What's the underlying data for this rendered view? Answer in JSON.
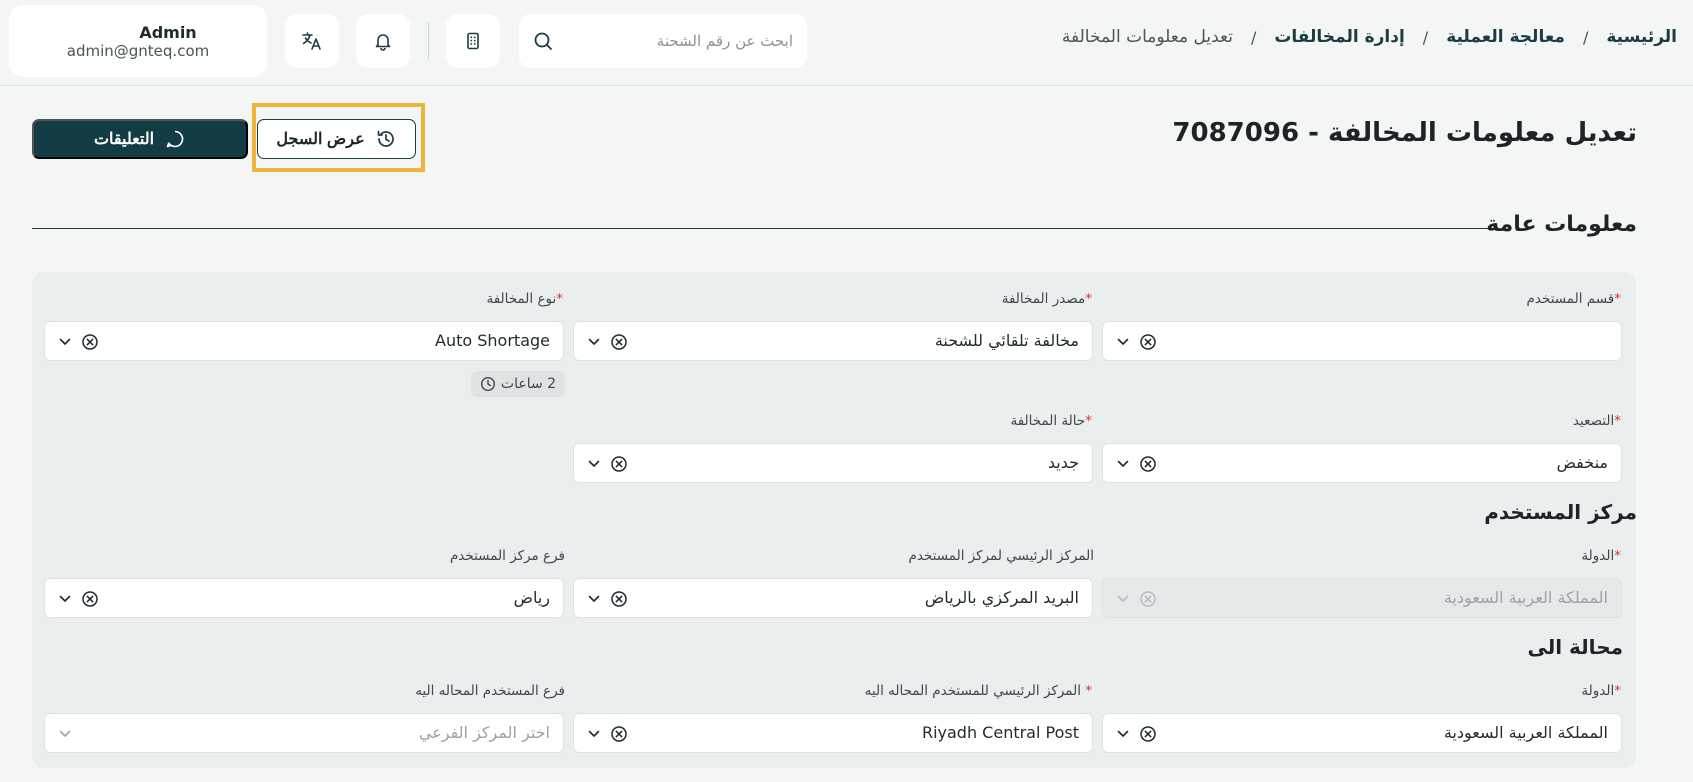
{
  "breadcrumb": {
    "items": [
      "الرئيسية",
      "معالجة العملية",
      "إدارة المخالفات"
    ],
    "current": "تعديل معلومات المخالفة",
    "separator": "/"
  },
  "search": {
    "placeholder": "ابحث عن رقم الشحنة"
  },
  "user": {
    "name": "Admin",
    "email": "admin@gnteq.com"
  },
  "page": {
    "title": "تعديل معلومات المخالفة - 7087096",
    "comments_label": "التعليقات",
    "history_label": "عرض السجل"
  },
  "general_info": {
    "heading": "معلومات عامة",
    "user_department": {
      "label": "قسم المستخدم",
      "value": ""
    },
    "violation_source": {
      "label": "مصدر المخالفة",
      "value": "مخالفة تلقائي للشحنة"
    },
    "violation_type": {
      "label": "نوع المخالفة",
      "value": "Auto Shortage"
    },
    "time_badge": "2 ساعات",
    "escalation": {
      "label": "التصعيد",
      "value": "منخفض"
    },
    "violation_status": {
      "label": "حالة المخالفة",
      "value": "جديد"
    }
  },
  "user_center": {
    "heading": "مركز المستخدم",
    "country": {
      "label": "الدولة",
      "value": "المملكة العربية السعودية"
    },
    "main_center": {
      "label": "المركز الرئيسي لمركز المستخدم",
      "value": "البريد المركزي بالرياض"
    },
    "branch": {
      "label": "فرع مركز المستخدم",
      "value": "رياض"
    }
  },
  "referred_to": {
    "heading": "محالة الى",
    "country": {
      "label": "الدولة",
      "value": "المملكة العربية السعودية"
    },
    "main_center": {
      "label": "المركز الرئيسي للمستخدم المحاله اليه",
      "value": "Riyadh Central Post"
    },
    "branch": {
      "label": "فرع المستخدم المحاله اليه",
      "placeholder": "اختر المركز الفرعي"
    }
  },
  "colors": {
    "primary": "#143c44",
    "highlight": "#f0b43c",
    "required": "#dd3333",
    "background": "#f4f5f5",
    "panel": "#ebeeee"
  },
  "icons": [
    "search-icon",
    "building-icon",
    "bell-icon",
    "translate-icon",
    "history-icon",
    "comment-icon",
    "clock-icon",
    "clear-icon",
    "chevron-down-icon"
  ]
}
